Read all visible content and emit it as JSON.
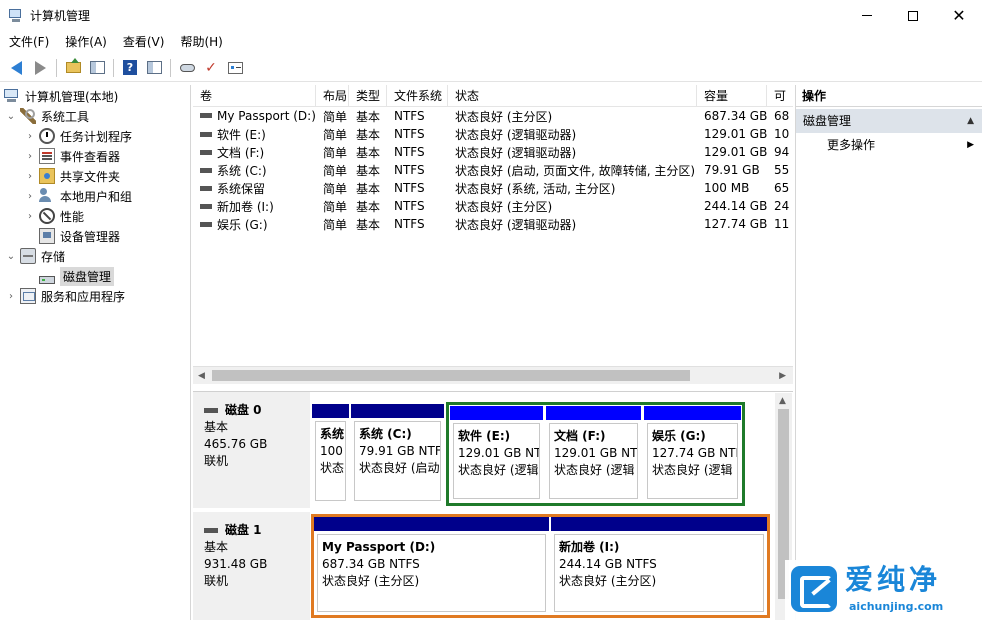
{
  "window": {
    "title": "计算机管理"
  },
  "menu": [
    "文件(F)",
    "操作(A)",
    "查看(V)",
    "帮助(H)"
  ],
  "tree": [
    {
      "label": "计算机管理(本地)",
      "expander": "",
      "icon": "computer-icon"
    },
    {
      "label": "系统工具",
      "expander": "v",
      "icon": "tools-icon"
    },
    {
      "label": "任务计划程序",
      "expander": ">",
      "icon": "clock-icon"
    },
    {
      "label": "事件查看器",
      "expander": ">",
      "icon": "event-viewer-icon"
    },
    {
      "label": "共享文件夹",
      "expander": ">",
      "icon": "shared-folder-icon"
    },
    {
      "label": "本地用户和组",
      "expander": ">",
      "icon": "users-icon"
    },
    {
      "label": "性能",
      "expander": ">",
      "icon": "performance-icon"
    },
    {
      "label": "设备管理器",
      "expander": "",
      "icon": "device-manager-icon"
    },
    {
      "label": "存储",
      "expander": "v",
      "icon": "storage-icon"
    },
    {
      "label": "磁盘管理",
      "expander": "",
      "icon": "disk-icon",
      "selected": true
    },
    {
      "label": "服务和应用程序",
      "expander": ">",
      "icon": "services-icon"
    }
  ],
  "columns": [
    "卷",
    "布局",
    "类型",
    "文件系统",
    "状态",
    "容量",
    "可"
  ],
  "volumes": [
    {
      "name": "My Passport (D:)",
      "layout": "简单",
      "type": "基本",
      "fs": "NTFS",
      "status": "状态良好 (主分区)",
      "capacity": "687.34 GB",
      "free": "68"
    },
    {
      "name": "软件 (E:)",
      "layout": "简单",
      "type": "基本",
      "fs": "NTFS",
      "status": "状态良好 (逻辑驱动器)",
      "capacity": "129.01 GB",
      "free": "10"
    },
    {
      "name": "文档 (F:)",
      "layout": "简单",
      "type": "基本",
      "fs": "NTFS",
      "status": "状态良好 (逻辑驱动器)",
      "capacity": "129.01 GB",
      "free": "94"
    },
    {
      "name": "系统 (C:)",
      "layout": "简单",
      "type": "基本",
      "fs": "NTFS",
      "status": "状态良好 (启动, 页面文件, 故障转储, 主分区)",
      "capacity": "79.91 GB",
      "free": "55"
    },
    {
      "name": "系统保留",
      "layout": "简单",
      "type": "基本",
      "fs": "NTFS",
      "status": "状态良好 (系统, 活动, 主分区)",
      "capacity": "100 MB",
      "free": "65"
    },
    {
      "name": "新加卷 (I:)",
      "layout": "简单",
      "type": "基本",
      "fs": "NTFS",
      "status": "状态良好 (主分区)",
      "capacity": "244.14 GB",
      "free": "24"
    },
    {
      "name": "娱乐 (G:)",
      "layout": "简单",
      "type": "基本",
      "fs": "NTFS",
      "status": "状态良好 (逻辑驱动器)",
      "capacity": "127.74 GB",
      "free": "11"
    }
  ],
  "disks": [
    {
      "name": "磁盘 0",
      "kind": "基本",
      "size": "465.76 GB",
      "state": "联机",
      "partitions": [
        {
          "name": "系统",
          "line2": "100",
          "line3": "状态"
        },
        {
          "name": "系统  (C:)",
          "line2": "79.91 GB NTF",
          "line3": "状态良好 (启动"
        },
        {
          "name": "软件  (E:)",
          "line2": "129.01 GB NT",
          "line3": "状态良好 (逻辑"
        },
        {
          "name": "文档  (F:)",
          "line2": "129.01 GB NTI",
          "line3": "状态良好 (逻辑"
        },
        {
          "name": "娱乐  (G:)",
          "line2": "127.74 GB NTI",
          "line3": "状态良好 (逻辑"
        }
      ]
    },
    {
      "name": "磁盘 1",
      "kind": "基本",
      "size": "931.48 GB",
      "state": "联机",
      "partitions": [
        {
          "name": "My Passport  (D:)",
          "line2": "687.34 GB NTFS",
          "line3": "状态良好 (主分区)"
        },
        {
          "name": "新加卷  (I:)",
          "line2": "244.14 GB NTFS",
          "line3": "状态良好 (主分区)"
        }
      ]
    }
  ],
  "actions": {
    "title": "操作",
    "section": "磁盘管理",
    "more": "更多操作"
  },
  "watermark": {
    "brand": "爱纯净",
    "url": "aichunjing.com"
  },
  "colors": {
    "primary_partition_bar": "#00008b",
    "logical_partition_bar": "#0000ff",
    "extended_frame": "#1f7a2a",
    "selected_frame": "#e07a22",
    "watermark": "#1a86d8"
  }
}
